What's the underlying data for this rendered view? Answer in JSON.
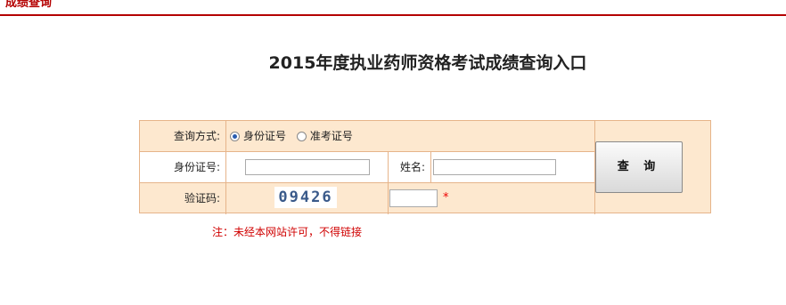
{
  "topbar": {
    "text": "成绩查询"
  },
  "page_title": "2015年度执业药师资格考试成绩查询入口",
  "form": {
    "query_method_label": "查询方式:",
    "options": [
      {
        "label": "身份证号",
        "selected": true
      },
      {
        "label": "准考证号",
        "selected": false
      }
    ],
    "id_label": "身份证号:",
    "id_value": "",
    "name_label": "姓名:",
    "name_value": "",
    "captcha_label": "验证码:",
    "captcha_image_text": "09426",
    "captcha_value": "",
    "required_mark": "*"
  },
  "query_button": "查 询",
  "note": "注：未经本网站许可，不得链接",
  "colors": {
    "accent": "#b40000",
    "form_bg": "#fde8cf",
    "form_border": "#e6b48a",
    "warning": "#d00000"
  }
}
